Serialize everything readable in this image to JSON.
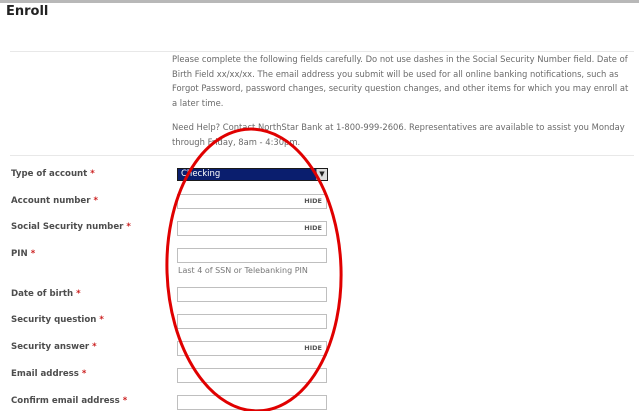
{
  "page": {
    "title": "Enroll",
    "instructions": "Please complete the following fields carefully. Do not use dashes in the Social Security Number field. Date of Birth Field xx/xx/xx. The email address you submit will be used for all online banking notifications, such as Forgot Password, password changes, security question changes, and other items for which you may enroll at a later time.",
    "help_text": "Need Help? Contact NorthStar Bank at 1-800-999-2606. Representatives are available to assist you Monday through Friday, 8am - 4:30pm."
  },
  "form": {
    "required_marker": "*",
    "account_type": {
      "label": "Type of account",
      "selected": "Checking"
    },
    "account_number": {
      "label": "Account number",
      "value": "",
      "hide_label": "HIDE"
    },
    "ssn": {
      "label": "Social Security number",
      "value": "",
      "hide_label": "HIDE"
    },
    "pin": {
      "label": "PIN",
      "value": "",
      "hint": "Last 4 of SSN or Telebanking PIN"
    },
    "dob": {
      "label": "Date of birth",
      "value": ""
    },
    "security_question": {
      "label": "Security question",
      "value": ""
    },
    "security_answer": {
      "label": "Security answer",
      "value": "",
      "hide_label": "HIDE"
    },
    "email": {
      "label": "Email address",
      "value": ""
    },
    "confirm_email": {
      "label": "Confirm email address",
      "value": ""
    }
  },
  "colors": {
    "required": "#cc2020",
    "annotation": "#e00000",
    "selected_option": "#0a1e6e"
  },
  "icons": {
    "select_arrow": "dropdown-arrow-icon"
  }
}
